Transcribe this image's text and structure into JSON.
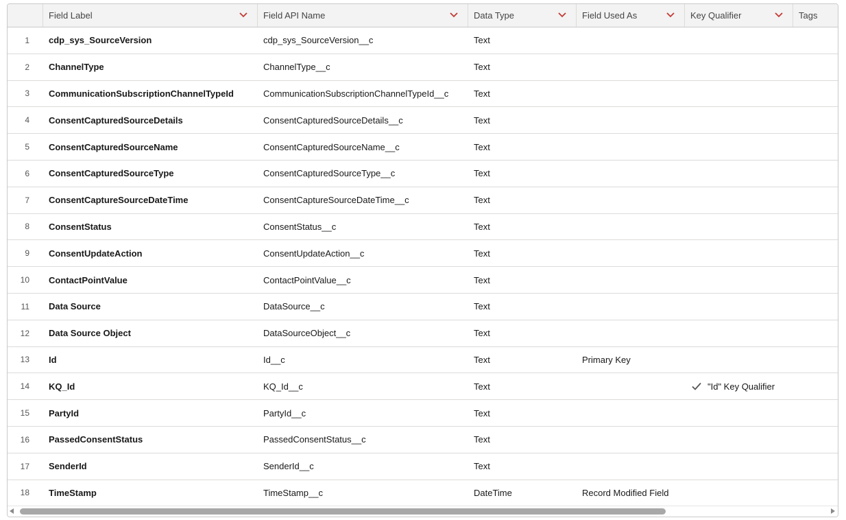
{
  "table": {
    "columns": [
      {
        "key": "row_number",
        "label": ""
      },
      {
        "key": "field_label",
        "label": "Field Label"
      },
      {
        "key": "field_api_name",
        "label": "Field API Name"
      },
      {
        "key": "data_type",
        "label": "Data Type"
      },
      {
        "key": "field_used_as",
        "label": "Field Used As"
      },
      {
        "key": "key_qualifier",
        "label": "Key Qualifier"
      },
      {
        "key": "tags",
        "label": "Tags"
      }
    ],
    "rows": [
      {
        "n": "1",
        "label": "cdp_sys_SourceVersion",
        "api": "cdp_sys_SourceVersion__c",
        "type": "Text",
        "used": "",
        "kq": "",
        "tags": ""
      },
      {
        "n": "2",
        "label": "ChannelType",
        "api": "ChannelType__c",
        "type": "Text",
        "used": "",
        "kq": "",
        "tags": ""
      },
      {
        "n": "3",
        "label": "CommunicationSubscriptionChannelTypeId",
        "api": "CommunicationSubscriptionChannelTypeId__c",
        "type": "Text",
        "used": "",
        "kq": "",
        "tags": ""
      },
      {
        "n": "4",
        "label": "ConsentCapturedSourceDetails",
        "api": "ConsentCapturedSourceDetails__c",
        "type": "Text",
        "used": "",
        "kq": "",
        "tags": ""
      },
      {
        "n": "5",
        "label": "ConsentCapturedSourceName",
        "api": "ConsentCapturedSourceName__c",
        "type": "Text",
        "used": "",
        "kq": "",
        "tags": ""
      },
      {
        "n": "6",
        "label": "ConsentCapturedSourceType",
        "api": "ConsentCapturedSourceType__c",
        "type": "Text",
        "used": "",
        "kq": "",
        "tags": ""
      },
      {
        "n": "7",
        "label": "ConsentCaptureSourceDateTime",
        "api": "ConsentCaptureSourceDateTime__c",
        "type": "Text",
        "used": "",
        "kq": "",
        "tags": ""
      },
      {
        "n": "8",
        "label": "ConsentStatus",
        "api": "ConsentStatus__c",
        "type": "Text",
        "used": "",
        "kq": "",
        "tags": ""
      },
      {
        "n": "9",
        "label": "ConsentUpdateAction",
        "api": "ConsentUpdateAction__c",
        "type": "Text",
        "used": "",
        "kq": "",
        "tags": ""
      },
      {
        "n": "10",
        "label": "ContactPointValue",
        "api": "ContactPointValue__c",
        "type": "Text",
        "used": "",
        "kq": "",
        "tags": ""
      },
      {
        "n": "11",
        "label": "Data Source",
        "api": "DataSource__c",
        "type": "Text",
        "used": "",
        "kq": "",
        "tags": ""
      },
      {
        "n": "12",
        "label": "Data Source Object",
        "api": "DataSourceObject__c",
        "type": "Text",
        "used": "",
        "kq": "",
        "tags": ""
      },
      {
        "n": "13",
        "label": "Id",
        "api": "Id__c",
        "type": "Text",
        "used": "Primary Key",
        "kq": "",
        "tags": ""
      },
      {
        "n": "14",
        "label": "KQ_Id",
        "api": "KQ_Id__c",
        "type": "Text",
        "used": "",
        "kq": "\"Id\" Key Qualifier",
        "kq_check": true,
        "tags": ""
      },
      {
        "n": "15",
        "label": "PartyId",
        "api": "PartyId__c",
        "type": "Text",
        "used": "",
        "kq": "",
        "tags": ""
      },
      {
        "n": "16",
        "label": "PassedConsentStatus",
        "api": "PassedConsentStatus__c",
        "type": "Text",
        "used": "",
        "kq": "",
        "tags": ""
      },
      {
        "n": "17",
        "label": "SenderId",
        "api": "SenderId__c",
        "type": "Text",
        "used": "",
        "kq": "",
        "tags": ""
      },
      {
        "n": "18",
        "label": "TimeStamp",
        "api": "TimeStamp__c",
        "type": "DateTime",
        "used": "Record Modified Field",
        "kq": "",
        "tags": ""
      }
    ]
  },
  "icons": {
    "column_menu": "chevron-down-icon",
    "key_qualifier_check": "check-icon",
    "scroll_left": "arrow-left-icon",
    "scroll_right": "arrow-right-icon"
  },
  "colors": {
    "chevron": "#c23934",
    "header_bg": "#f3f3f3",
    "border": "#dddbda"
  }
}
